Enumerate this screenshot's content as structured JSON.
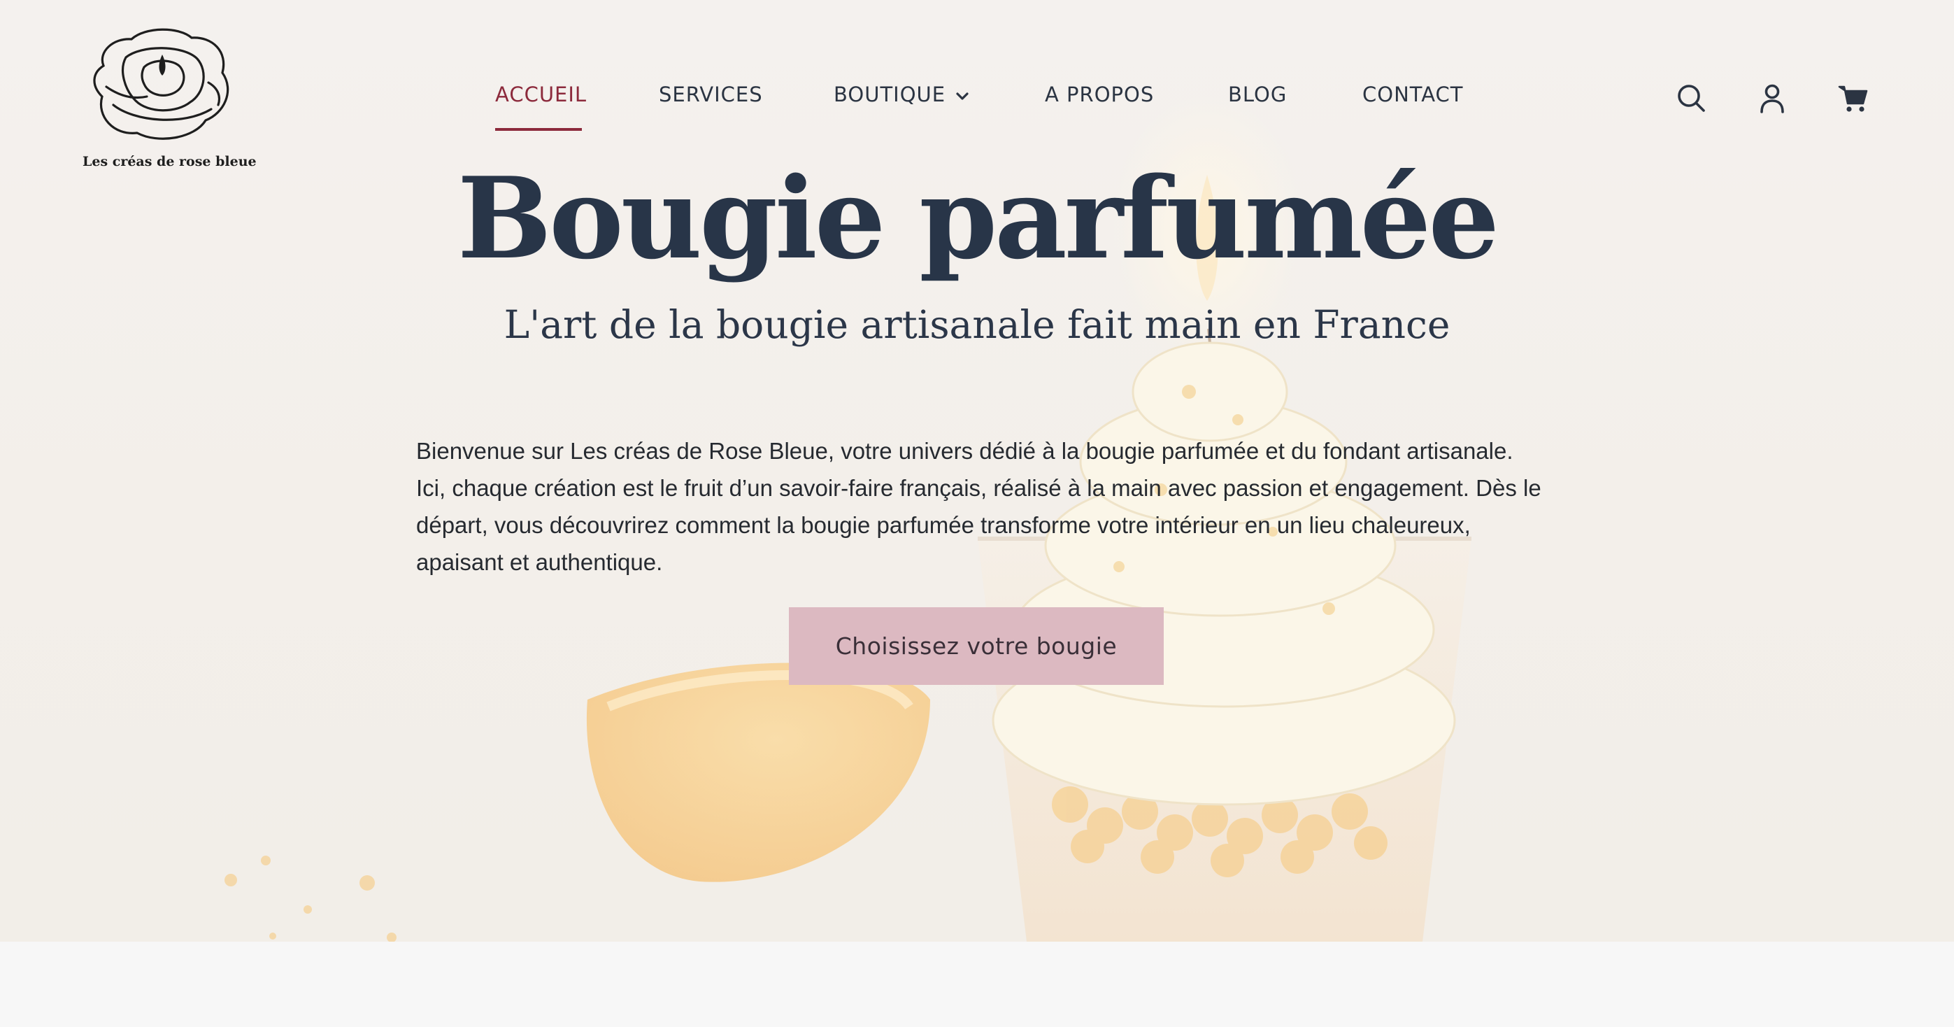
{
  "brand": {
    "logo_text": "Les créas de rose bleue"
  },
  "nav": {
    "items": [
      {
        "label": "ACCUEIL",
        "active": true
      },
      {
        "label": "SERVICES",
        "active": false
      },
      {
        "label": "BOUTIQUE",
        "active": false,
        "has_dropdown": true
      },
      {
        "label": "A PROPOS",
        "active": false
      },
      {
        "label": "BLOG",
        "active": false
      },
      {
        "label": "CONTACT",
        "active": false
      }
    ]
  },
  "header_icons": [
    "search-icon",
    "account-icon",
    "cart-icon"
  ],
  "hero": {
    "title": "Bougie parfumée",
    "subtitle": "L'art de la bougie artisanale fait main en France",
    "intro": "Bienvenue sur Les créas de Rose Bleue, votre univers dédié à la bougie parfumée et du fondant artisanale. Ici, chaque création est le fruit d’un savoir-faire français, réalisé à la main avec passion et engagement. Dès le départ, vous découvrirez comment la bougie parfumée transforme votre intérieur en un lieu chaleureux, apaisant et authentique.",
    "cta_label": "Choisissez votre bougie"
  },
  "colors": {
    "accent": "#8c2a3c",
    "text_dark": "#283548",
    "cta_bg": "#dcb9c1",
    "page_bg": "#f7f7f7"
  }
}
